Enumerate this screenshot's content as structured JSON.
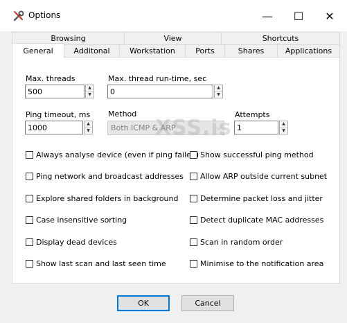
{
  "window": {
    "title": "Options",
    "minimize": "—",
    "maximize": "☐",
    "close": "✕",
    "icon": "wrench-screwdriver-icon"
  },
  "tabs": {
    "row1": [
      "Browsing",
      "View",
      "Shortcuts"
    ],
    "row2": [
      "General",
      "Additonal",
      "Workstation",
      "Ports",
      "Shares",
      "Applications"
    ],
    "active": "General"
  },
  "general": {
    "max_threads": {
      "label": "Max. threads",
      "value": "500"
    },
    "max_thread_runtime": {
      "label": "Max. thread run-time, sec",
      "value": "0"
    },
    "ping_timeout": {
      "label": "Ping timeout, ms",
      "value": "1000"
    },
    "method": {
      "label": "Method",
      "value": "Both ICMP & ARP"
    },
    "attempts": {
      "label": "Attempts",
      "value": "1"
    },
    "checkboxes_left": [
      {
        "label": "Always analyse device (even if ping failed)",
        "checked": false
      },
      {
        "label": "Ping network and broadcast addresses",
        "checked": false
      },
      {
        "label": "Explore shared folders in background",
        "checked": false
      },
      {
        "label": "Case insensitive sorting",
        "checked": false
      },
      {
        "label": "Display dead devices",
        "checked": false
      },
      {
        "label": "Show last scan and last seen time",
        "checked": false
      }
    ],
    "checkboxes_right": [
      {
        "label": "Show successful ping method",
        "checked": false
      },
      {
        "label": "Allow ARP outside current subnet",
        "checked": false
      },
      {
        "label": "Determine packet loss and jitter",
        "checked": false
      },
      {
        "label": "Detect duplicate MAC addresses",
        "checked": false
      },
      {
        "label": "Scan in random order",
        "checked": false
      },
      {
        "label": "Minimise to the notification area",
        "checked": false
      }
    ]
  },
  "watermark": "XSS.is",
  "buttons": {
    "ok": "OK",
    "cancel": "Cancel"
  },
  "colors": {
    "accent": "#0078d7",
    "dialog_bg": "#f0f0f0",
    "panel_bg": "#ffffff"
  }
}
